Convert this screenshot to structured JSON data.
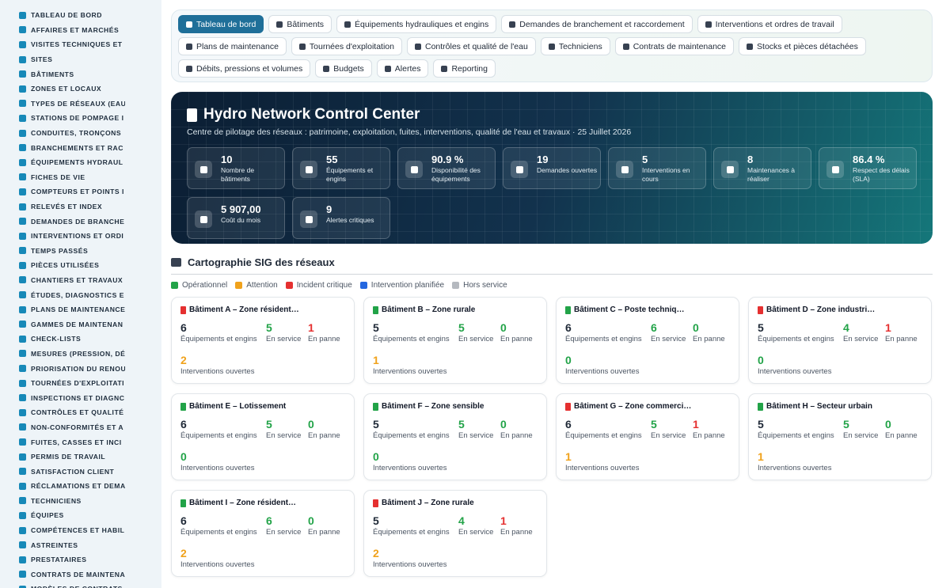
{
  "colors": {
    "green": "#22a348",
    "orange": "#f0a21c",
    "red": "#e53030",
    "blue": "#2467e0",
    "grey": "#b5b9bf",
    "dark": "#1f2937"
  },
  "sidebar": {
    "items": [
      "TABLEAU DE BORD",
      "AFFAIRES ET MARCHÉS",
      "VISITES TECHNIQUES ET",
      "SITES",
      "BÂTIMENTS",
      "ZONES ET LOCAUX",
      "TYPES DE RÉSEAUX (EAU",
      "STATIONS DE POMPAGE I",
      "CONDUITES, TRONÇONS",
      "BRANCHEMENTS ET RAC",
      "ÉQUIPEMENTS HYDRAUL",
      "FICHES DE VIE",
      "COMPTEURS ET POINTS I",
      "RELEVÉS ET INDEX",
      "DEMANDES DE BRANCHE",
      "INTERVENTIONS ET ORDI",
      "TEMPS PASSÉS",
      "PIÈCES UTILISÉES",
      "CHANTIERS ET TRAVAUX",
      "ÉTUDES, DIAGNOSTICS E",
      "PLANS DE MAINTENANCE",
      "GAMMES DE MAINTENAN",
      "CHECK-LISTS",
      "MESURES (PRESSION, DÉ",
      "PRIORISATION DU RENOU",
      "TOURNÉES D'EXPLOITATI",
      "INSPECTIONS ET DIAGNC",
      "CONTRÔLES ET QUALITÉ",
      "NON-CONFORMITÉS ET A",
      "FUITES, CASSES ET INCI",
      "PERMIS DE TRAVAIL",
      "SATISFACTION CLIENT",
      "RÉCLAMATIONS ET DEMA",
      "TECHNICIENS",
      "ÉQUIPES",
      "COMPÉTENCES ET HABIL",
      "ASTREINTES",
      "PRESTATAIRES",
      "CONTRATS DE MAINTENA",
      "MODÈLES DE CONTRATS"
    ]
  },
  "nav": {
    "rows": [
      [
        "Tableau de bord",
        "Bâtiments",
        "Équipements hydrauliques et engins",
        "Demandes de branchement et raccordement",
        "Interventions et ordres de travail"
      ],
      [
        "Plans de maintenance",
        "Tournées d'exploitation",
        "Contrôles et qualité de l'eau",
        "Techniciens",
        "Contrats de maintenance",
        "Stocks et pièces détachées"
      ],
      [
        "Débits, pressions et volumes",
        "Budgets",
        "Alertes",
        "Reporting"
      ]
    ],
    "active": "Tableau de bord"
  },
  "hero": {
    "title": "Hydro Network Control Center",
    "subtitle": "Centre de pilotage des réseaux : patrimoine, exploitation, fuites, interventions, qualité de l'eau et travaux · 25 Juillet 2026",
    "kpis": [
      {
        "value": "10",
        "label": "Nombre de bâtiments",
        "icon": "building-icon"
      },
      {
        "value": "55",
        "label": "Équipements et engins",
        "icon": "gears-icon"
      },
      {
        "value": "90.9 %",
        "label": "Disponibilité des équipements",
        "icon": "heart-pulse-icon"
      },
      {
        "value": "19",
        "label": "Demandes ouvertes",
        "icon": "question-icon"
      },
      {
        "value": "5",
        "label": "Interventions en cours",
        "icon": "clipboard-check-icon"
      },
      {
        "value": "8",
        "label": "Maintenances à réaliser",
        "icon": "calendar-icon"
      },
      {
        "value": "86.4 %",
        "label": "Respect des délais (SLA)",
        "icon": "stopwatch-icon"
      },
      {
        "value": "5 907,00",
        "label": "Coût du mois",
        "icon": "money-icon"
      },
      {
        "value": "9",
        "label": "Alertes critiques",
        "icon": "bell-icon"
      }
    ]
  },
  "section": {
    "title": "Cartographie SIG des réseaux",
    "legend": [
      {
        "label": "Opérationnel",
        "color": "#22a348"
      },
      {
        "label": "Attention",
        "color": "#f0a21c"
      },
      {
        "label": "Incident critique",
        "color": "#e53030"
      },
      {
        "label": "Intervention planifiée",
        "color": "#2467e0"
      },
      {
        "label": "Hors service",
        "color": "#b5b9bf"
      }
    ]
  },
  "labels": {
    "equip": "Équipements et engins",
    "service": "En service",
    "panne": "En panne",
    "interv": "Interventions ouvertes"
  },
  "buildings": [
    {
      "name": "Bâtiment A – Zone résident…",
      "status": "red",
      "equip": "6",
      "service": "5",
      "panne": "1",
      "interv": "2"
    },
    {
      "name": "Bâtiment B – Zone rurale",
      "status": "green",
      "equip": "5",
      "service": "5",
      "panne": "0",
      "interv": "1"
    },
    {
      "name": "Bâtiment C – Poste techniq…",
      "status": "green",
      "equip": "6",
      "service": "6",
      "panne": "0",
      "interv": "0"
    },
    {
      "name": "Bâtiment D – Zone industri…",
      "status": "red",
      "equip": "5",
      "service": "4",
      "panne": "1",
      "interv": "0"
    },
    {
      "name": "Bâtiment E – Lotissement",
      "status": "green",
      "equip": "6",
      "service": "5",
      "panne": "0",
      "interv": "0"
    },
    {
      "name": "Bâtiment F – Zone sensible",
      "status": "green",
      "equip": "5",
      "service": "5",
      "panne": "0",
      "interv": "0"
    },
    {
      "name": "Bâtiment G – Zone commerci…",
      "status": "red",
      "equip": "6",
      "service": "5",
      "panne": "1",
      "interv": "1"
    },
    {
      "name": "Bâtiment H – Secteur urbain",
      "status": "green",
      "equip": "5",
      "service": "5",
      "panne": "0",
      "interv": "1"
    },
    {
      "name": "Bâtiment I – Zone résident…",
      "status": "green",
      "equip": "6",
      "service": "6",
      "panne": "0",
      "interv": "2"
    },
    {
      "name": "Bâtiment J – Zone rurale",
      "status": "red",
      "equip": "5",
      "service": "4",
      "panne": "1",
      "interv": "2"
    }
  ]
}
